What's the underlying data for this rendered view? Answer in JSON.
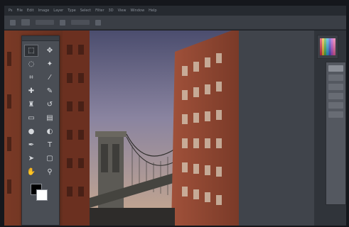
{
  "app": {
    "menu_items": [
      "Ps",
      "File",
      "Edit",
      "Image",
      "Layer",
      "Type",
      "Select",
      "Filter",
      "3D",
      "View",
      "Window",
      "Help"
    ]
  },
  "options_bar": {
    "label": ""
  },
  "tools": [
    {
      "name": "rectangular-marquee-tool",
      "glyph": "⬚",
      "selected": true
    },
    {
      "name": "move-tool",
      "glyph": "✥"
    },
    {
      "name": "lasso-tool",
      "glyph": "◌"
    },
    {
      "name": "magic-wand-tool",
      "glyph": "✦"
    },
    {
      "name": "crop-tool",
      "glyph": "⌗"
    },
    {
      "name": "eyedropper-tool",
      "glyph": "⁄"
    },
    {
      "name": "healing-brush-tool",
      "glyph": "✚"
    },
    {
      "name": "brush-tool",
      "glyph": "✎"
    },
    {
      "name": "clone-stamp-tool",
      "glyph": "♜"
    },
    {
      "name": "history-brush-tool",
      "glyph": "↺"
    },
    {
      "name": "eraser-tool",
      "glyph": "▭"
    },
    {
      "name": "gradient-tool",
      "glyph": "▤"
    },
    {
      "name": "blur-tool",
      "glyph": "●"
    },
    {
      "name": "dodge-tool",
      "glyph": "◐"
    },
    {
      "name": "pen-tool",
      "glyph": "✒"
    },
    {
      "name": "type-tool",
      "glyph": "T"
    },
    {
      "name": "path-selection-tool",
      "glyph": "➤"
    },
    {
      "name": "shape-tool",
      "glyph": "▢"
    },
    {
      "name": "hand-tool",
      "glyph": "✋"
    },
    {
      "name": "zoom-tool",
      "glyph": "⚲"
    }
  ],
  "colors": {
    "foreground": "#000000",
    "background": "#ffffff",
    "app_background": "#40444b",
    "panel": "#4a4e55"
  }
}
